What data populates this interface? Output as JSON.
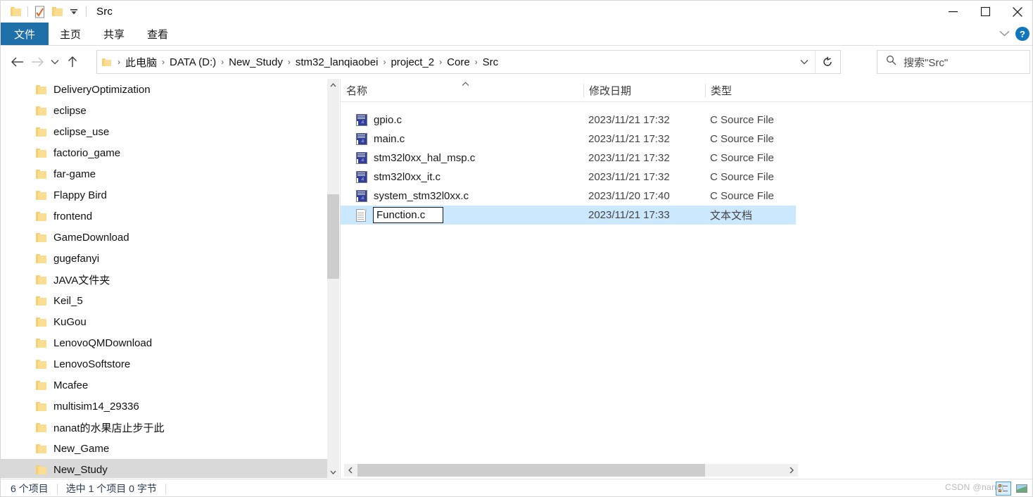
{
  "window": {
    "title": "Src",
    "quick_access": [
      {
        "name": "folder-icon",
        "label": "Src"
      },
      {
        "name": "properties-icon",
        "label": "属性"
      },
      {
        "name": "new-folder-icon",
        "label": "新建文件夹"
      },
      {
        "name": "customize-qat-icon",
        "label": "自定义快速访问工具栏"
      }
    ],
    "controls": [
      {
        "name": "minimize-button",
        "label": "最小化"
      },
      {
        "name": "maximize-button",
        "label": "最大化"
      },
      {
        "name": "close-button",
        "label": "关闭"
      }
    ]
  },
  "ribbon": {
    "tabs": [
      {
        "label": "文件",
        "active": true
      },
      {
        "label": "主页",
        "active": false
      },
      {
        "label": "共享",
        "active": false
      },
      {
        "label": "查看",
        "active": false
      }
    ],
    "expand_label": "展开功能区",
    "help_label": "?"
  },
  "navigation": {
    "back_label": "后退",
    "forward_label": "前进",
    "recent_label": "最近浏览的位置",
    "up_label": "上移到",
    "refresh_label": "刷新",
    "dropdown_label": "以前的位置",
    "breadcrumb": [
      "此电脑",
      "DATA (D:)",
      "New_Study",
      "stm32_lanqiaobei",
      "project_2",
      "Core",
      "Src"
    ],
    "separator": "›"
  },
  "search": {
    "placeholder": "搜索\"Src\"",
    "icon": "search-icon"
  },
  "sidebar": {
    "items": [
      {
        "label": "DeliveryOptimization",
        "selected": false
      },
      {
        "label": "eclipse",
        "selected": false
      },
      {
        "label": "eclipse_use",
        "selected": false
      },
      {
        "label": "factorio_game",
        "selected": false
      },
      {
        "label": "far-game",
        "selected": false
      },
      {
        "label": "Flappy Bird",
        "selected": false
      },
      {
        "label": "frontend",
        "selected": false
      },
      {
        "label": "GameDownload",
        "selected": false
      },
      {
        "label": "gugefanyi",
        "selected": false
      },
      {
        "label": "JAVA文件夹",
        "selected": false
      },
      {
        "label": "Keil_5",
        "selected": false
      },
      {
        "label": "KuGou",
        "selected": false
      },
      {
        "label": "LenovoQMDownload",
        "selected": false
      },
      {
        "label": "LenovoSoftstore",
        "selected": false
      },
      {
        "label": "Mcafee",
        "selected": false
      },
      {
        "label": "multisim14_29336",
        "selected": false
      },
      {
        "label": "nanat的水果店止步于此",
        "selected": false
      },
      {
        "label": "New_Game",
        "selected": false
      },
      {
        "label": "New_Study",
        "selected": true
      }
    ]
  },
  "filelist": {
    "columns": [
      {
        "label": "名称",
        "sorted": "asc"
      },
      {
        "label": "修改日期",
        "sorted": null
      },
      {
        "label": "类型",
        "sorted": null
      }
    ],
    "rows": [
      {
        "name": "gpio.c",
        "date": "2023/11/21 17:32",
        "type": "C Source File",
        "icon": "c-source-file-icon",
        "selected": false,
        "renaming": false
      },
      {
        "name": "main.c",
        "date": "2023/11/21 17:32",
        "type": "C Source File",
        "icon": "c-source-file-icon",
        "selected": false,
        "renaming": false
      },
      {
        "name": "stm32l0xx_hal_msp.c",
        "date": "2023/11/21 17:32",
        "type": "C Source File",
        "icon": "c-source-file-icon",
        "selected": false,
        "renaming": false
      },
      {
        "name": "stm32l0xx_it.c",
        "date": "2023/11/21 17:32",
        "type": "C Source File",
        "icon": "c-source-file-icon",
        "selected": false,
        "renaming": false
      },
      {
        "name": "system_stm32l0xx.c",
        "date": "2023/11/20 17:40",
        "type": "C Source File",
        "icon": "c-source-file-icon",
        "selected": false,
        "renaming": false
      },
      {
        "name": "Function.c",
        "date": "2023/11/21 17:33",
        "type": "文本文档",
        "icon": "text-document-icon",
        "selected": true,
        "renaming": true
      }
    ],
    "rename_value": "Function.c"
  },
  "statusbar": {
    "item_count": "6 个项目",
    "selection": "选中 1 个项目  0 字节",
    "view_details_label": "详细信息",
    "view_thumbnails_label": "大图标"
  },
  "watermark": {
    "text": "CSDN @nanat"
  },
  "colors": {
    "accent": "#1f6fa9",
    "selection": "#cce8ff",
    "tree_selection": "#d9d9d9",
    "folder": "#f7d071",
    "help_blue": "#1176bc"
  }
}
